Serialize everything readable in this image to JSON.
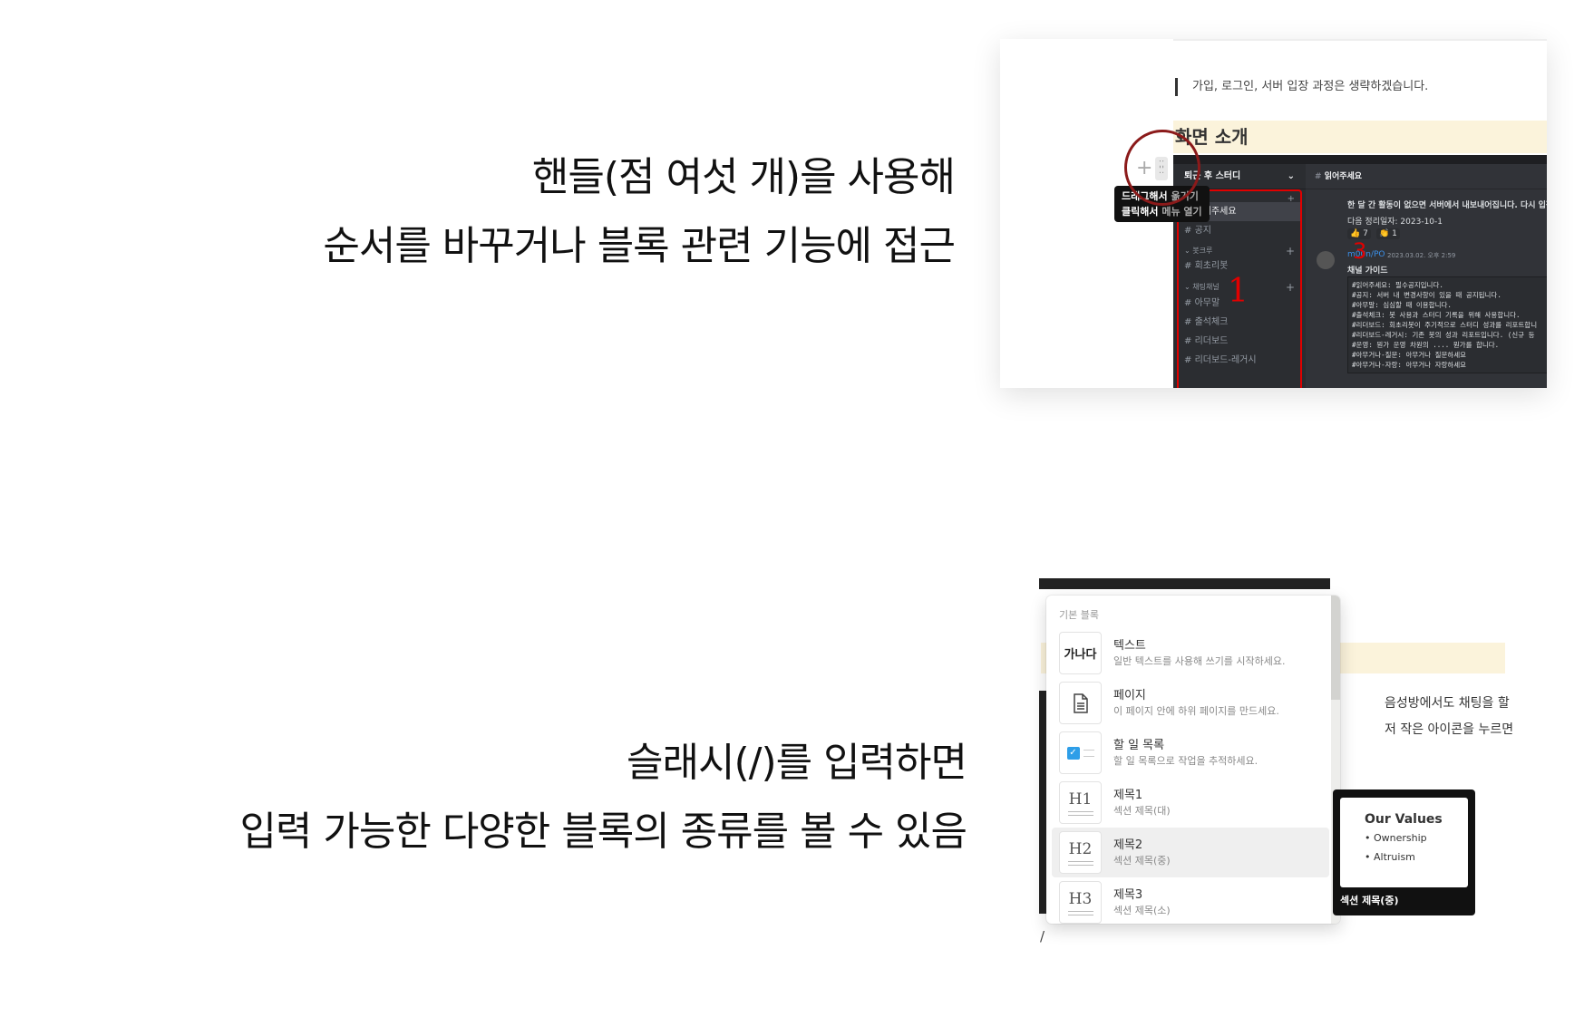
{
  "captions": {
    "top": [
      "핸들(점 여섯 개)을 사용해",
      "순서를 바꾸거나 블록 관련 기능에 접근"
    ],
    "bottom": [
      "슬래시(/)를 입력하면",
      "입력 가능한 다양한 블록의 종류를 볼 수 있음"
    ]
  },
  "top_panel": {
    "quote": "가입, 로그인, 서버 입장 과정은 생략하겠습니다.",
    "heading": "화면 소개",
    "handle_tooltip": {
      "line1_bold": "드래그해서",
      "line1_rest": "옮기기",
      "line2_bold": "클릭해서",
      "line2_rest": "메뉴 열기"
    },
    "discord": {
      "server_name": "퇴근 후 스터디",
      "channels_top": [
        "읽어주세요",
        "공지"
      ],
      "category1": "봇크루",
      "channels_bot": [
        "회초리봇"
      ],
      "category2": "채팅채널",
      "channels_chat": [
        "아무말",
        "출석체크",
        "리더보드",
        "리더보드-레거시"
      ],
      "current_channel": "읽어주세요",
      "pinned": "한 달 간 활동이 없으면 서버에서 내보내어집니다. 다시 입장",
      "next_cleanup": "다음 정리일자: 2023-10-1",
      "reaction1": "👍 7",
      "reaction2": "👏 1",
      "author": "m00n/PO",
      "timestamp": "2023.03.02. 오후 2:59",
      "message_title": "채널 가이드",
      "code_lines": [
        "#읽어주세요: 필수공지입니다.",
        "#공지: 서버 내 변경사항이 있을 때 공지됩니다.",
        "#아무말: 심심할 때 이용합니다.",
        "#출석체크: 봇 사용과 스터디 기록을 위해 사용합니다.",
        "#리더보드: 회초리봇이 주기적으로 스터디 성과를 리포트합니",
        "#리더보드-레거시: 기존 봇의 성과 리포트입니다. (신규 등",
        "#운영: 뭔가 운영 차원의 .... 뭔가를 합니다.",
        "#아무거나-질문: 아무거나 질문하세요",
        "#아무거나-자랑: 아무거나 자랑하세요"
      ],
      "annotation_1": "1",
      "annotation_3": "3"
    }
  },
  "slash_menu": {
    "section": "기본 블록",
    "items": [
      {
        "icon": "가나다",
        "title": "텍스트",
        "desc": "일반 텍스트를 사용해 쓰기를 시작하세요."
      },
      {
        "icon": "page-icon",
        "title": "페이지",
        "desc": "이 페이지 안에 하위 페이지를 만드세요."
      },
      {
        "icon": "todo-icon",
        "title": "할 일 목록",
        "desc": "할 일 목록으로 작업을 추적하세요."
      },
      {
        "icon": "H1",
        "title": "제목1",
        "desc": "섹션 제목(대)"
      },
      {
        "icon": "H2",
        "title": "제목2",
        "desc": "섹션 제목(중)"
      },
      {
        "icon": "H3",
        "title": "제목3",
        "desc": "섹션 제목(소)"
      }
    ],
    "selected_index": 4,
    "typed": "/"
  },
  "preview": {
    "title": "Our Values",
    "bullets": [
      "Ownership",
      "Altruism"
    ],
    "caption": "섹션 제목(중)"
  },
  "background_text": [
    "음성방에서도 채팅을 할",
    "저 작은 아이콘을 누르면"
  ]
}
